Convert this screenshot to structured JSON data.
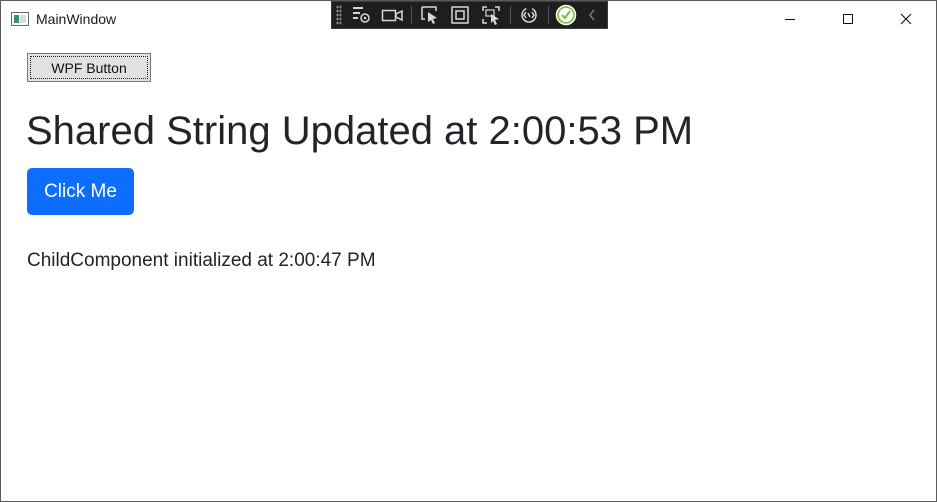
{
  "window": {
    "title": "MainWindow",
    "icons": {
      "app": "app-window-icon",
      "minimize": "minimize-icon",
      "maximize": "maximize-icon",
      "close": "close-icon"
    }
  },
  "debug_toolbar": {
    "tools": [
      "live-visual-tree-icon",
      "video-camera-icon",
      "select-element-icon",
      "display-layout-adorners-icon",
      "track-focus-icon",
      "hot-reload-icon",
      "binding-check-icon",
      "collapse-chevron-icon"
    ]
  },
  "content": {
    "wpf_button_label": "WPF Button",
    "heading": "Shared String Updated at 2:00:53 PM",
    "click_button_label": "Click Me",
    "child_status": "ChildComponent initialized at 2:00:47 PM"
  },
  "colors": {
    "primary_button": "#0d6efd",
    "text": "#212529",
    "check_green": "#7cc242"
  }
}
